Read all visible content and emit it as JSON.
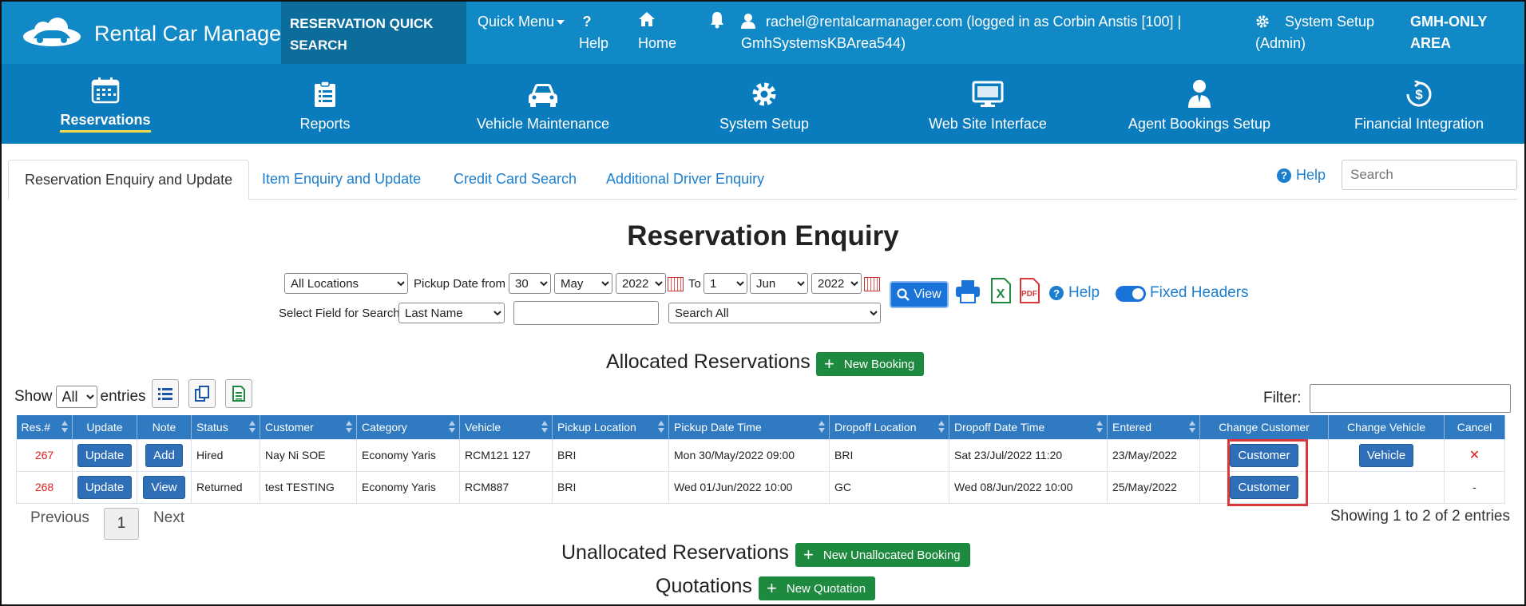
{
  "topbar": {
    "brand": "Rental Car Manager",
    "quick_search": "RESERVATION QUICK SEARCH",
    "quick_menu": "Quick Menu",
    "help": "Help",
    "home": "Home",
    "user_line1": "rachel@rentalcarmanager.com (logged in as Corbin Anstis [100] |",
    "user_line2": "GmhSystemsKBArea544)",
    "system_setup_line1": "System Setup",
    "system_setup_line2": "(Admin)",
    "area_line1": "GMH-ONLY",
    "area_line2": "AREA"
  },
  "mainnav": [
    {
      "label": "Reservations",
      "icon": "calendar-icon"
    },
    {
      "label": "Reports",
      "icon": "clipboard-icon"
    },
    {
      "label": "Vehicle Maintenance",
      "icon": "car-icon"
    },
    {
      "label": "System Setup",
      "icon": "gear-icon"
    },
    {
      "label": "Web Site Interface",
      "icon": "monitor-icon"
    },
    {
      "label": "Agent Bookings Setup",
      "icon": "agent-icon"
    },
    {
      "label": "Financial Integration",
      "icon": "dollar-refresh-icon"
    }
  ],
  "tabs": [
    "Reservation Enquiry and Update",
    "Item Enquiry and Update",
    "Credit Card Search",
    "Additional Driver Enquiry"
  ],
  "tab_help": "Help",
  "search": {
    "placeholder": "Search"
  },
  "page_title": "Reservation Enquiry",
  "filters": {
    "location": "All Locations",
    "pickup_from_label": "Pickup Date from",
    "from_day": "30",
    "from_month": "May",
    "from_year": "2022",
    "to_label": "To",
    "to_day": "1",
    "to_month": "Jun",
    "to_year": "2022",
    "view": "View",
    "help": "Help",
    "fixed_headers": "Fixed Headers",
    "select_field_label": "Select Field for Search",
    "field": "Last Name",
    "search_all": "Search All"
  },
  "allocated": {
    "title": "Allocated Reservations",
    "new_button": "New Booking",
    "show_label": "Show",
    "show_value": "All",
    "entries_label": "entries",
    "filter_label": "Filter:",
    "columns": [
      "Res.#",
      "Update",
      "Note",
      "Status",
      "Customer",
      "Category",
      "Vehicle",
      "Pickup Location",
      "Pickup Date Time",
      "Dropoff Location",
      "Dropoff Date Time",
      "Entered",
      "Change Customer",
      "Change Vehicle",
      "Cancel"
    ],
    "rows": [
      {
        "res": "267",
        "update": "Update",
        "note": "Add",
        "status": "Hired",
        "customer": "Nay Ni SOE",
        "category": "Economy Yaris",
        "vehicle": "RCM121 127",
        "pickup_location": "BRI",
        "pickup_dt": "Mon 30/May/2022 09:00",
        "dropoff_location": "BRI",
        "dropoff_dt": "Sat 23/Jul/2022 11:20",
        "entered": "23/May/2022",
        "change_customer": "Customer",
        "change_vehicle": "Vehicle",
        "cancel": "✕"
      },
      {
        "res": "268",
        "update": "Update",
        "note": "View",
        "status": "Returned",
        "customer": "test TESTING",
        "category": "Economy Yaris",
        "vehicle": "RCM887",
        "pickup_location": "BRI",
        "pickup_dt": "Wed 01/Jun/2022 10:00",
        "dropoff_location": "GC",
        "dropoff_dt": "Wed 08/Jun/2022 10:00",
        "entered": "25/May/2022",
        "change_customer": "Customer",
        "change_vehicle": "",
        "cancel": "-"
      }
    ],
    "pager": {
      "previous": "Previous",
      "page": "1",
      "next": "Next"
    },
    "showing": "Showing 1 to 2 of 2 entries"
  },
  "unallocated": {
    "title": "Unallocated Reservations",
    "new_button": "New Unallocated Booking"
  },
  "quotations": {
    "title": "Quotations",
    "new_button": "New Quotation"
  }
}
